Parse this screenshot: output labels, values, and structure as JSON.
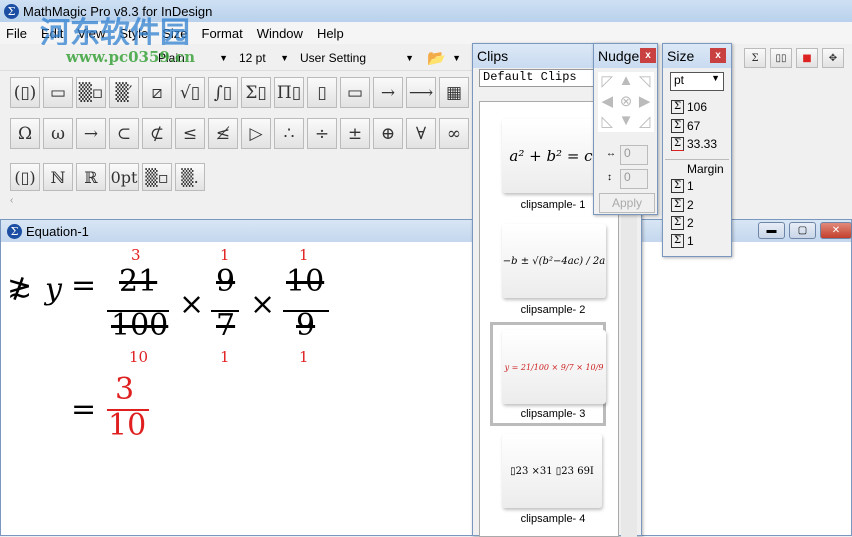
{
  "app": {
    "title": "MathMagic Pro v8.3 for InDesign"
  },
  "watermark": {
    "cn": "河东软件园",
    "url": "www.pc0359.cn"
  },
  "menu": [
    "File",
    "Edit",
    "View",
    "Style",
    "Size",
    "Format",
    "Window",
    "Help"
  ],
  "toolbar": {
    "style": "Plain",
    "size": "12 pt",
    "setting": "User Setting"
  },
  "palette_row1": [
    "(▯)",
    "▭",
    "▒▫",
    "▒′",
    "⧄",
    "√▯",
    "∫▯",
    "Σ▯",
    "Π▯",
    "▯",
    "▭",
    "→",
    "⟶",
    "▦"
  ],
  "palette_row2": [
    "Ω",
    "ω",
    "→",
    "⊂",
    "⊄",
    "≤",
    "≰",
    "▷",
    "∴",
    "÷",
    "±",
    "⊕",
    "∀",
    "∞"
  ],
  "palette_row3": [
    "(▯)",
    "ℕ",
    "ℝ",
    "0pt",
    "▒▫",
    "▒."
  ],
  "equation_window": {
    "title": "Equation-1"
  },
  "equation": {
    "lhs_symbol": "≵",
    "var": "y",
    "eq": "=",
    "n1": "21",
    "d1": "100",
    "n1c": "3",
    "d1c": "10",
    "times": "×",
    "n2": "9",
    "d2": "7",
    "n2c": "1",
    "d2c": "1",
    "n3": "10",
    "d3": "9",
    "n3c": "1",
    "d3c": "1",
    "rn": "3",
    "rd": "10"
  },
  "clips": {
    "title": "Clips",
    "library": "Default Clips",
    "items": [
      {
        "label": "clipsample- 1",
        "formula": "a² + b² = c²"
      },
      {
        "label": "clipsample- 2",
        "formula": "−b ± √(b²−4ac) / 2a"
      },
      {
        "label": "clipsample- 3",
        "formula": "y = 21/100 × 9/7 × 10/9"
      },
      {
        "label": "clipsample- 4",
        "formula": "▯23 ×31 ▯23 69I"
      }
    ]
  },
  "nudge": {
    "title": "Nudge",
    "h": "0",
    "v": "0",
    "apply": "Apply"
  },
  "size": {
    "title": "Size",
    "unit": "pt",
    "width": "106",
    "height": "67",
    "baseline": "33.33",
    "margin_label": "Margin",
    "margins": [
      "1",
      "2",
      "2",
      "1"
    ]
  }
}
